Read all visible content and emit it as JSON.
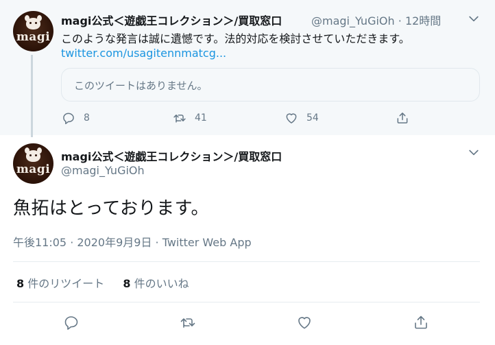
{
  "parent_tweet": {
    "avatar_text": "magi",
    "display_name": "magi公式＜遊戯王コレクション＞/買取窓口",
    "handle": "@magi_YuGiOh",
    "separator": "·",
    "time": "12時間",
    "text": "このような発言は誠に遺憾です。法的対応を検討させていただきます。",
    "link": "twitter.com/usagitennmatcg...",
    "quoted_tweet_unavailable": "このツイートはありません。",
    "reply_count": "8",
    "retweet_count": "41",
    "like_count": "54"
  },
  "main_tweet": {
    "avatar_text": "magi",
    "display_name": "magi公式＜遊戯王コレクション＞/買取窓口",
    "handle": "@magi_YuGiOh",
    "text": "魚拓はとっております。",
    "timestamp": "午後11:05 · 2020年9月9日 · Twitter Web App",
    "retweets": {
      "count": "8",
      "label": "件のリツイート"
    },
    "likes": {
      "count": "8",
      "label": "件のいいね"
    }
  },
  "icons": {
    "reply": "reply-icon",
    "retweet": "retweet-icon",
    "like": "heart-icon",
    "share": "share-icon",
    "more": "chevron-down-icon"
  },
  "colors": {
    "link": "#1b95e0",
    "secondary_text": "#657786",
    "icon": "#657786",
    "parent_background": "#f5f8fa"
  }
}
